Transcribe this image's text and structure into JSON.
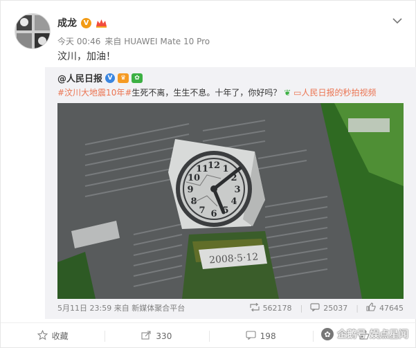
{
  "author": {
    "name": "成龙",
    "verified_mark": "V"
  },
  "meta": {
    "time": "今天 00:46",
    "source": "来自 HUAWEI Mate 10 Pro"
  },
  "text": "汶川，加油！",
  "repost": {
    "author": "@人民日报",
    "topic": "#汶川大地震10年#",
    "body": "生死不离，生生不息。十年了，你好吗？",
    "video_link": "人民日报的秒拍视频",
    "video": {
      "stone_inscription": "2008·5·12",
      "clock_numerals": [
        "12",
        "1",
        "2",
        "3",
        "4",
        "5",
        "6",
        "7",
        "8",
        "9",
        "10",
        "11"
      ]
    },
    "footer": {
      "time": "5月11日 23:59",
      "source": "来自 新媒体聚合平台",
      "reposts": "562178",
      "comments": "25037",
      "likes": "47645"
    }
  },
  "actions": {
    "favorite": "收藏",
    "repost": "330",
    "comment": "198"
  },
  "watermark": "企鹅号 娱点星闻",
  "icons": {
    "chevron": "chevron-down-icon",
    "repost": "repost-icon",
    "comment": "comment-icon",
    "like": "thumbs-up-icon",
    "favorite": "star-icon",
    "video": "video-icon"
  },
  "colors": {
    "accent": "#eb7350",
    "verified": "#f29b15",
    "ribbon": "#3cb043"
  }
}
